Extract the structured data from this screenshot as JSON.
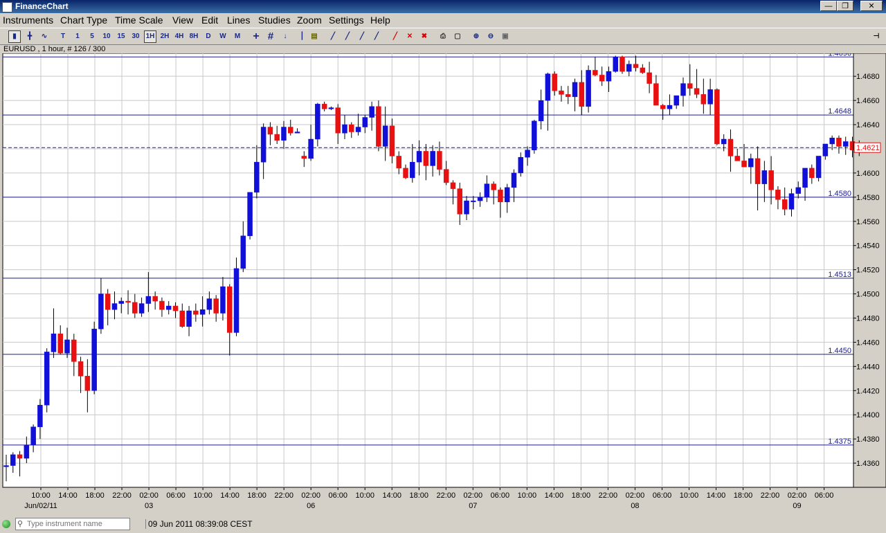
{
  "window": {
    "title": "FinanceChart",
    "controls": [
      "minimize-icon",
      "restore-icon",
      "close-icon"
    ]
  },
  "menu": [
    "Instruments",
    "Chart Type",
    "Time Scale",
    "View",
    "Edit",
    "Lines",
    "Studies",
    "Zoom",
    "Settings",
    "Help"
  ],
  "toolbar": {
    "timeframes": [
      "T",
      "1",
      "5",
      "10",
      "15",
      "30",
      "1H",
      "2H",
      "4H",
      "8H",
      "D",
      "W",
      "M"
    ],
    "selected_timeframe": "1H"
  },
  "chart_info": "EURUSD , 1 hour, # 126 / 300",
  "status": {
    "search_placeholder": "Type instrument name",
    "datetime": "09 Jun 2011 08:39:08 CEST"
  },
  "colors": {
    "bull": "#1010d8",
    "bear": "#e81010",
    "line": "#1a1a90",
    "grid": "#c8c8c8",
    "price_tag": "#e81010"
  },
  "chart_data": {
    "type": "candlestick",
    "symbol": "EURUSD",
    "ylim": [
      1.434,
      1.4699
    ],
    "y_ticks": [
      "1.4360",
      "1.4380",
      "1.4400",
      "1.4420",
      "1.4440",
      "1.4460",
      "1.4480",
      "1.4500",
      "1.4520",
      "1.4540",
      "1.4560",
      "1.4580",
      "1.4600",
      "1.4620",
      "1.4640",
      "1.4660",
      "1.4680"
    ],
    "y_tick_step": 0.002,
    "x_tick_labels": [
      "10:00",
      "14:00",
      "18:00",
      "22:00",
      "02:00",
      "06:00",
      "10:00",
      "14:00",
      "18:00",
      "22:00",
      "02:00",
      "06:00",
      "10:00",
      "14:00",
      "18:00",
      "22:00",
      "02:00",
      "06:00",
      "10:00",
      "14:00",
      "18:00",
      "22:00",
      "02:00",
      "06:00",
      "10:00",
      "14:00",
      "18:00",
      "22:00",
      "02:00",
      "06:00"
    ],
    "date_labels": [
      {
        "label": "Jun/02/11",
        "tick": 0
      },
      {
        "label": "03",
        "tick": 4
      },
      {
        "label": "06",
        "tick": 10
      },
      {
        "label": "07",
        "tick": 16
      },
      {
        "label": "08",
        "tick": 22
      },
      {
        "label": "09",
        "tick": 28
      }
    ],
    "horizontal_lines": [
      1.4696,
      1.4648,
      1.458,
      1.4513,
      1.445,
      1.4375
    ],
    "horizontal_line_labels": [
      "1.4696",
      "1.4648",
      "1.4580",
      "1.4513",
      "1.4450",
      "1.4375"
    ],
    "current_price": 1.4621,
    "current_price_label": "1.4621",
    "candles": [
      [
        1.4357,
        1.4367,
        1.4345,
        1.4358
      ],
      [
        1.4358,
        1.4369,
        1.4352,
        1.4367
      ],
      [
        1.4367,
        1.437,
        1.4349,
        1.4364
      ],
      [
        1.4364,
        1.4382,
        1.436,
        1.4375
      ],
      [
        1.4375,
        1.4392,
        1.4369,
        1.439
      ],
      [
        1.439,
        1.4413,
        1.438,
        1.4408
      ],
      [
        1.4408,
        1.4455,
        1.4402,
        1.4452
      ],
      [
        1.4452,
        1.4488,
        1.4447,
        1.4467
      ],
      [
        1.4467,
        1.4474,
        1.445,
        1.4451
      ],
      [
        1.4451,
        1.4472,
        1.4447,
        1.4462
      ],
      [
        1.4462,
        1.4467,
        1.4432,
        1.4444
      ],
      [
        1.4444,
        1.4448,
        1.4418,
        1.4432
      ],
      [
        1.4432,
        1.4446,
        1.4402,
        1.442
      ],
      [
        1.442,
        1.4477,
        1.4417,
        1.4471
      ],
      [
        1.4471,
        1.4513,
        1.4467,
        1.45
      ],
      [
        1.45,
        1.4504,
        1.4474,
        1.4487
      ],
      [
        1.4487,
        1.4502,
        1.4479,
        1.4492
      ],
      [
        1.4492,
        1.4497,
        1.4484,
        1.4494
      ],
      [
        1.4494,
        1.4503,
        1.4483,
        1.4493
      ],
      [
        1.4493,
        1.45,
        1.448,
        1.4484
      ],
      [
        1.4484,
        1.4497,
        1.4481,
        1.4492
      ],
      [
        1.4492,
        1.4518,
        1.4485,
        1.4498
      ],
      [
        1.4498,
        1.4502,
        1.4487,
        1.4494
      ],
      [
        1.4494,
        1.4497,
        1.4481,
        1.4487
      ],
      [
        1.4487,
        1.4494,
        1.4483,
        1.449
      ],
      [
        1.449,
        1.4493,
        1.448,
        1.4486
      ],
      [
        1.4486,
        1.4492,
        1.4472,
        1.4473
      ],
      [
        1.4473,
        1.449,
        1.4465,
        1.4486
      ],
      [
        1.4486,
        1.4492,
        1.4477,
        1.4483
      ],
      [
        1.4483,
        1.4498,
        1.4473,
        1.4487
      ],
      [
        1.4487,
        1.4502,
        1.4483,
        1.4496
      ],
      [
        1.4496,
        1.4499,
        1.4477,
        1.4484
      ],
      [
        1.4484,
        1.4514,
        1.4478,
        1.4506
      ],
      [
        1.4506,
        1.4508,
        1.4449,
        1.4468
      ],
      [
        1.4468,
        1.453,
        1.4465,
        1.4521
      ],
      [
        1.4521,
        1.456,
        1.4518,
        1.4548
      ],
      [
        1.4548,
        1.4584,
        1.4545,
        1.4584
      ],
      [
        1.4584,
        1.4623,
        1.4579,
        1.4609
      ],
      [
        1.4609,
        1.4641,
        1.4595,
        1.4638
      ],
      [
        1.4638,
        1.4642,
        1.4623,
        1.4632
      ],
      [
        1.4632,
        1.4639,
        1.4624,
        1.4627
      ],
      [
        1.4627,
        1.4643,
        1.462,
        1.4638
      ],
      [
        1.4638,
        1.4644,
        1.4631,
        1.4633
      ],
      [
        1.4633,
        1.4637,
        1.4633,
        1.4634
      ],
      [
        1.4614,
        1.4618,
        1.4605,
        1.4612
      ],
      [
        1.4612,
        1.464,
        1.461,
        1.4628
      ],
      [
        1.4628,
        1.4658,
        1.4622,
        1.4657
      ],
      [
        1.4657,
        1.4659,
        1.4651,
        1.4653
      ],
      [
        1.4653,
        1.4655,
        1.4652,
        1.4654
      ],
      [
        1.4654,
        1.4657,
        1.4624,
        1.4633
      ],
      [
        1.4633,
        1.4648,
        1.4628,
        1.464
      ],
      [
        1.464,
        1.4642,
        1.4629,
        1.4634
      ],
      [
        1.4634,
        1.4649,
        1.4631,
        1.4638
      ],
      [
        1.4638,
        1.4648,
        1.4633,
        1.4646
      ],
      [
        1.4646,
        1.4659,
        1.4635,
        1.4655
      ],
      [
        1.4655,
        1.466,
        1.4618,
        1.4622
      ],
      [
        1.4622,
        1.4655,
        1.461,
        1.4639
      ],
      [
        1.4639,
        1.4645,
        1.4608,
        1.4614
      ],
      [
        1.4614,
        1.4618,
        1.4599,
        1.4604
      ],
      [
        1.4604,
        1.4607,
        1.4595,
        1.4596
      ],
      [
        1.4596,
        1.4624,
        1.4592,
        1.4609
      ],
      [
        1.4609,
        1.4627,
        1.4598,
        1.4618
      ],
      [
        1.4618,
        1.4624,
        1.4594,
        1.4606
      ],
      [
        1.4606,
        1.4623,
        1.4597,
        1.4618
      ],
      [
        1.4618,
        1.4626,
        1.4598,
        1.4603
      ],
      [
        1.4603,
        1.461,
        1.459,
        1.4592
      ],
      [
        1.4592,
        1.4594,
        1.4574,
        1.4587
      ],
      [
        1.4587,
        1.4592,
        1.4557,
        1.4566
      ],
      [
        1.4566,
        1.4581,
        1.4561,
        1.4577
      ],
      [
        1.4577,
        1.4581,
        1.457,
        1.4577
      ],
      [
        1.4577,
        1.4584,
        1.4572,
        1.458
      ],
      [
        1.458,
        1.4598,
        1.4576,
        1.4591
      ],
      [
        1.4591,
        1.4593,
        1.4574,
        1.4586
      ],
      [
        1.4586,
        1.4588,
        1.4563,
        1.4576
      ],
      [
        1.4576,
        1.4591,
        1.4567,
        1.4588
      ],
      [
        1.4588,
        1.4603,
        1.4576,
        1.46
      ],
      [
        1.46,
        1.4617,
        1.4597,
        1.4613
      ],
      [
        1.4613,
        1.4622,
        1.4606,
        1.4619
      ],
      [
        1.4619,
        1.4644,
        1.4616,
        1.4643
      ],
      [
        1.4643,
        1.4669,
        1.4636,
        1.466
      ],
      [
        1.466,
        1.4683,
        1.4635,
        1.4682
      ],
      [
        1.4682,
        1.4684,
        1.4664,
        1.4668
      ],
      [
        1.4668,
        1.4672,
        1.4659,
        1.4665
      ],
      [
        1.4665,
        1.4672,
        1.4657,
        1.4663
      ],
      [
        1.4663,
        1.4678,
        1.4651,
        1.4675
      ],
      [
        1.4675,
        1.4685,
        1.4648,
        1.4655
      ],
      [
        1.4655,
        1.4689,
        1.465,
        1.4685
      ],
      [
        1.4685,
        1.4696,
        1.468,
        1.4681
      ],
      [
        1.4681,
        1.4688,
        1.4672,
        1.4676
      ],
      [
        1.4676,
        1.4688,
        1.4667,
        1.4684
      ],
      [
        1.4684,
        1.4697,
        1.4683,
        1.4696
      ],
      [
        1.4696,
        1.4697,
        1.4682,
        1.4684
      ],
      [
        1.4684,
        1.4693,
        1.468,
        1.469
      ],
      [
        1.469,
        1.4697,
        1.4684,
        1.4687
      ],
      [
        1.4687,
        1.469,
        1.4682,
        1.4683
      ],
      [
        1.4683,
        1.4692,
        1.4666,
        1.4674
      ],
      [
        1.4674,
        1.4681,
        1.4664,
        1.4656
      ],
      [
        1.4656,
        1.4657,
        1.4644,
        1.4653
      ],
      [
        1.4653,
        1.4665,
        1.4648,
        1.4656
      ],
      [
        1.4656,
        1.4661,
        1.4653,
        1.4664
      ],
      [
        1.4664,
        1.4679,
        1.4655,
        1.4674
      ],
      [
        1.4674,
        1.469,
        1.4664,
        1.467
      ],
      [
        1.467,
        1.4686,
        1.4662,
        1.4665
      ],
      [
        1.4665,
        1.4678,
        1.4649,
        1.4657
      ],
      [
        1.4657,
        1.4678,
        1.4648,
        1.4669
      ],
      [
        1.4669,
        1.467,
        1.4623,
        1.4624
      ],
      [
        1.4624,
        1.4632,
        1.4618,
        1.4628
      ],
      [
        1.4628,
        1.4636,
        1.4601,
        1.4614
      ],
      [
        1.4614,
        1.462,
        1.461,
        1.461
      ],
      [
        1.461,
        1.4624,
        1.4608,
        1.4605
      ],
      [
        1.4605,
        1.4616,
        1.4591,
        1.4612
      ],
      [
        1.4612,
        1.4622,
        1.4569,
        1.4591
      ],
      [
        1.4591,
        1.461,
        1.4576,
        1.4602
      ],
      [
        1.4602,
        1.4614,
        1.4574,
        1.4586
      ],
      [
        1.4586,
        1.4589,
        1.457,
        1.4578
      ],
      [
        1.4578,
        1.4588,
        1.4565,
        1.457
      ],
      [
        1.457,
        1.4587,
        1.4564,
        1.4583
      ],
      [
        1.4583,
        1.4593,
        1.4579,
        1.4588
      ],
      [
        1.4588,
        1.4604,
        1.4577,
        1.4604
      ],
      [
        1.4604,
        1.4607,
        1.4591,
        1.4596
      ],
      [
        1.4596,
        1.4614,
        1.4593,
        1.4614
      ],
      [
        1.4614,
        1.4624,
        1.4611,
        1.4624
      ],
      [
        1.4624,
        1.4631,
        1.4619,
        1.4629
      ],
      [
        1.4629,
        1.4631,
        1.4616,
        1.4622
      ],
      [
        1.4622,
        1.463,
        1.4615,
        1.4626
      ],
      [
        1.4626,
        1.463,
        1.4613,
        1.4619
      ],
      [
        1.4619,
        1.4627,
        1.4614,
        1.4621
      ]
    ]
  }
}
